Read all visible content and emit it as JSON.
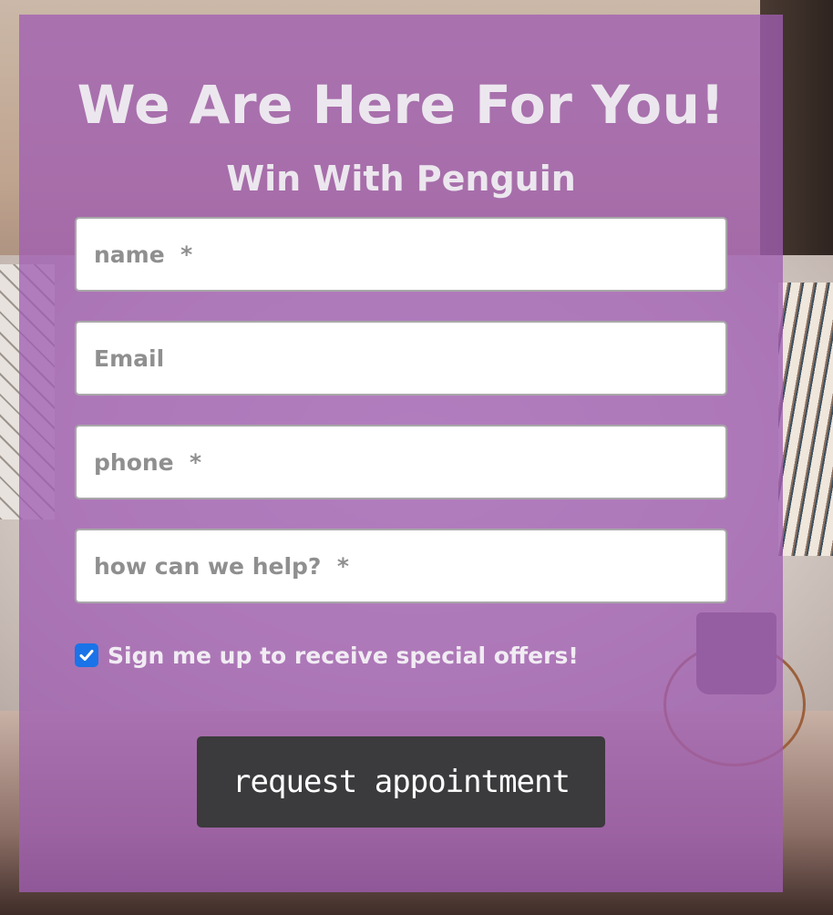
{
  "form": {
    "title": "We Are Here For You!",
    "subtitle": "Win With Penguin",
    "fields": {
      "name": {
        "placeholder": "name  *",
        "value": ""
      },
      "email": {
        "placeholder": "Email",
        "value": ""
      },
      "phone": {
        "placeholder": "phone  *",
        "value": ""
      },
      "message": {
        "placeholder": "how can we help?  *",
        "value": ""
      }
    },
    "offers_checkbox": {
      "checked": true,
      "label": "Sign me up to receive special offers!"
    },
    "submit_label": "request appointment"
  },
  "colors": {
    "overlay": "#a05fb2",
    "button": "#3b3a3c",
    "checkbox": "#1a73e8",
    "heading_text": "#ece7ee"
  },
  "icons": {
    "checkbox_mark": "check-icon"
  }
}
